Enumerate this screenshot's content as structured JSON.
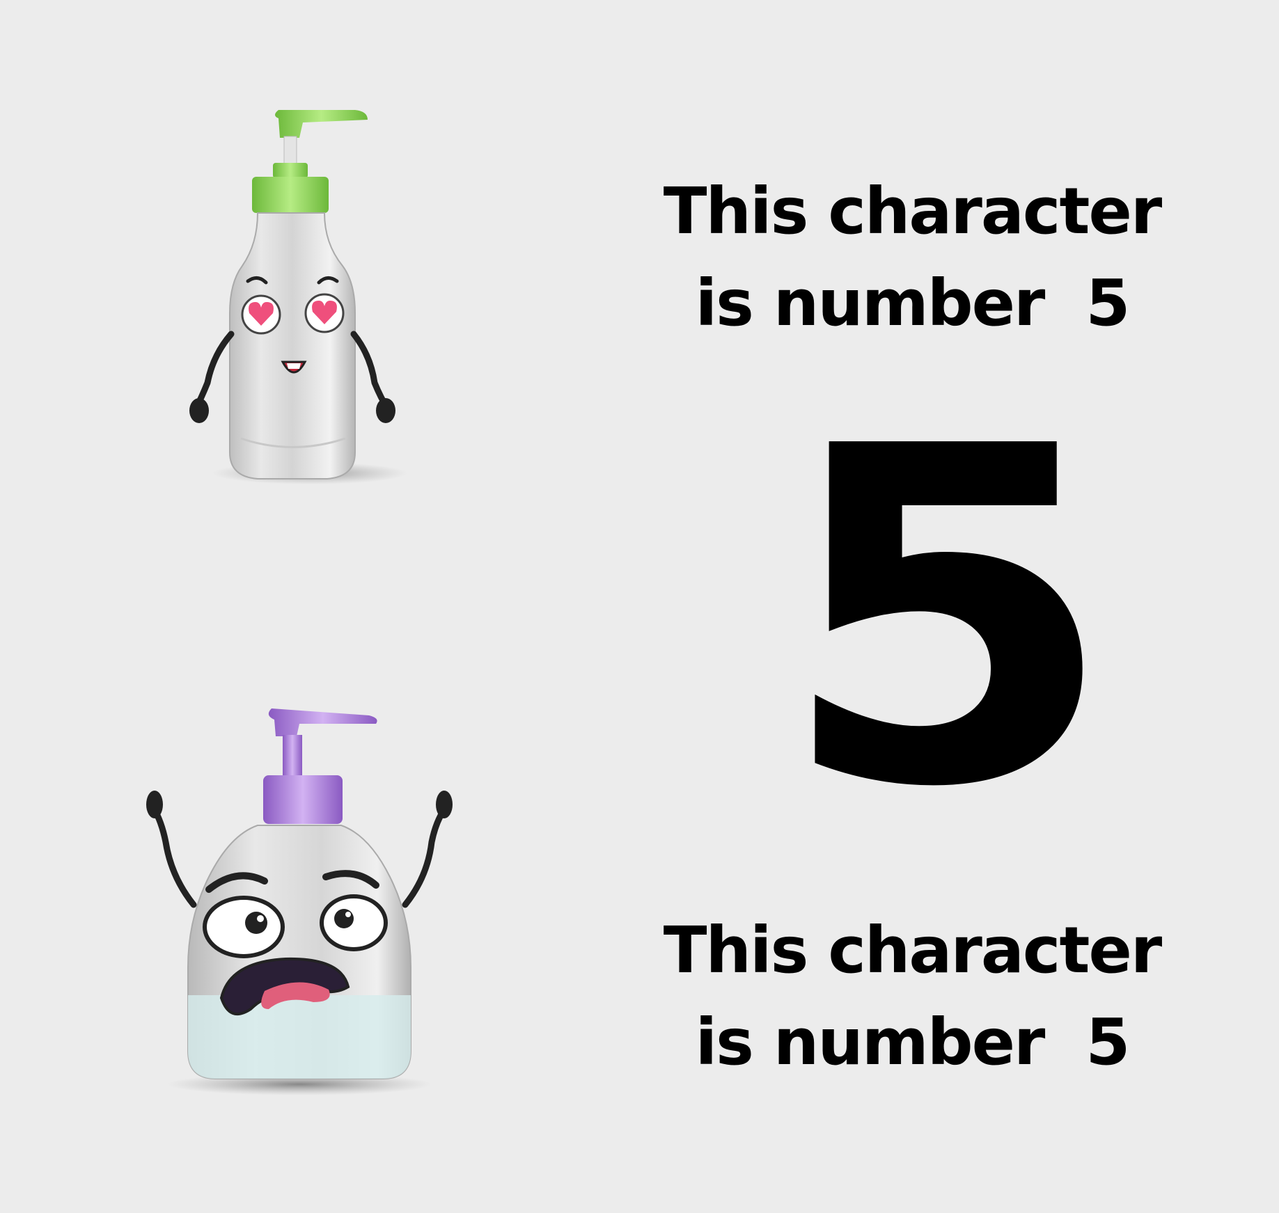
{
  "captions": {
    "top": {
      "line1": "This character",
      "line2": "is number  5"
    },
    "bottom": {
      "line1": "This character",
      "line2": "is number  5"
    }
  },
  "big_number": "5",
  "characters": [
    {
      "name": "green-pump-bottle-character",
      "expression": "heart-eyes",
      "cap_color": "#8fd14f"
    },
    {
      "name": "purple-pump-bottle-character",
      "expression": "shocked",
      "cap_color": "#b07fe0"
    }
  ],
  "colors": {
    "background": "#ececec",
    "text": "#000000"
  }
}
